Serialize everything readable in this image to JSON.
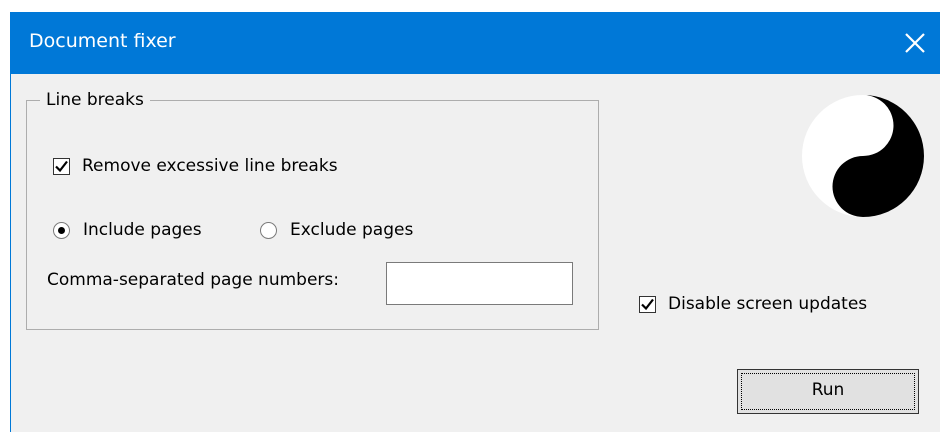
{
  "window": {
    "title": "Document fixer"
  },
  "group": {
    "legend": "Line breaks",
    "remove_breaks": {
      "label": "Remove excessive line breaks",
      "checked": true
    },
    "page_mode": {
      "options": [
        "Include pages",
        "Exclude pages"
      ],
      "selected": "Include pages"
    },
    "page_numbers": {
      "label": "Comma-separated page numbers:",
      "value": ""
    }
  },
  "disable_updates": {
    "label": "Disable screen updates",
    "checked": true
  },
  "run": {
    "label": "Run"
  },
  "icons": {
    "close": "close-icon",
    "logo": "yin-yang-icon"
  },
  "colors": {
    "titlebar": "#0078d7",
    "dialog": "#f0f0f0"
  }
}
